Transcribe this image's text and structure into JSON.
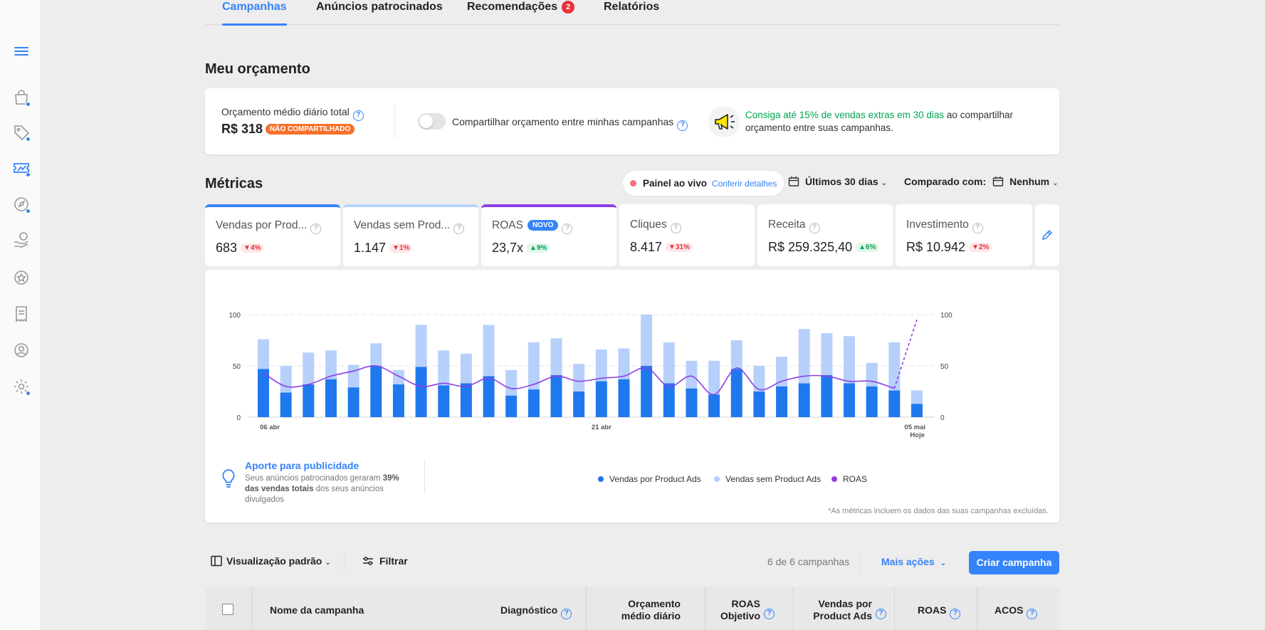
{
  "tabs": [
    {
      "label": "Campanhas"
    },
    {
      "label": "Anúncios patrocinados"
    },
    {
      "label": "Recomendações",
      "badge": "2"
    },
    {
      "label": "Relatórios"
    }
  ],
  "sidebar": {
    "icons": [
      "menu-icon",
      "shopping-bag-icon",
      "tag-icon",
      "ads-ticket-icon",
      "compass-icon",
      "money-hand-icon",
      "star-badge-icon",
      "receipt-icon",
      "user-icon",
      "settings-icon"
    ]
  },
  "budget": {
    "title": "Meu orçamento",
    "label": "Orçamento médio diário total",
    "value": "R$ 318",
    "badge": "NÃO COMPARTILHADO",
    "share_label": "Compartilhar orçamento entre minhas campanhas",
    "promo_highlight": "Consiga até 15% de vendas extras em 30 dias",
    "promo_rest": " ao compartilhar orçamento entre suas campanhas."
  },
  "metrics": {
    "title": "Métricas",
    "live_label": "Painel ao vivo",
    "live_link": "Conferir detalhes",
    "period": "Últimos 30 dias",
    "compare_label": "Comparado com:",
    "compare_value": "Nenhum",
    "tiles": [
      {
        "name": "Vendas por Prod...",
        "value": "683",
        "delta": "▼4%"
      },
      {
        "name": "Vendas sem Prod...",
        "value": "1.147",
        "delta": "▼1%"
      },
      {
        "name": "ROAS",
        "badge": "NOVO",
        "value": "23,7x",
        "delta": "▲9%"
      },
      {
        "name": "Cliques",
        "value": "8.417",
        "delta": "▼31%"
      },
      {
        "name": "Receita",
        "value": "R$ 259.325,40",
        "delta": "▲6%"
      },
      {
        "name": "Investimento",
        "value": "R$ 10.942",
        "delta": "▼2%"
      }
    ]
  },
  "chart_data": {
    "type": "bar",
    "categories": [
      "06 abr",
      "07 abr",
      "08 abr",
      "09 abr",
      "10 abr",
      "11 abr",
      "12 abr",
      "13 abr",
      "14 abr",
      "15 abr",
      "16 abr",
      "17 abr",
      "18 abr",
      "19 abr",
      "20 abr",
      "21 abr",
      "22 abr",
      "23 abr",
      "24 abr",
      "25 abr",
      "26 abr",
      "27 abr",
      "28 abr",
      "29 abr",
      "30 abr",
      "01 mai",
      "02 mai",
      "03 mai",
      "04 mai",
      "05 mai"
    ],
    "x_tick_labels": [
      "06 abr",
      "21 abr",
      "05 mai"
    ],
    "x_tick_sublabel": "Hoje",
    "ylim": [
      0,
      100
    ],
    "y_ticks": [
      "0",
      "50",
      "100"
    ],
    "grid": true,
    "series": [
      {
        "name": "Vendas por Product Ads",
        "color": "#1f78ee",
        "values": [
          47,
          24,
          32,
          37,
          29,
          50,
          32,
          49,
          31,
          33,
          40,
          21,
          27,
          41,
          25,
          35,
          37,
          50,
          33,
          28,
          22,
          47,
          25,
          30,
          33,
          41,
          33,
          30,
          26,
          13
        ]
      },
      {
        "name": "Vendas sem Product Ads",
        "color": "#b7d0fb",
        "values": [
          29,
          26,
          31,
          28,
          22,
          22,
          14,
          41,
          34,
          29,
          50,
          25,
          46,
          36,
          27,
          31,
          30,
          50,
          40,
          27,
          33,
          28,
          25,
          29,
          53,
          41,
          46,
          23,
          47,
          13
        ]
      },
      {
        "name": "ROAS",
        "color": "#8c3fe6",
        "type": "line",
        "values": [
          43,
          30,
          32,
          40,
          45,
          50,
          40,
          30,
          33,
          30,
          38,
          28,
          32,
          40,
          35,
          38,
          40,
          48,
          30,
          40,
          22,
          48,
          27,
          35,
          40,
          40,
          35,
          35,
          28,
          95
        ]
      }
    ],
    "legend_position": "bottom-center"
  },
  "insight": {
    "title": "Aporte para publicidade",
    "text_1": "Seus anúncios patrocinados geraram ",
    "bold_1": "39% das vendas totais",
    "text_2": " dos seus anúncios divulgados"
  },
  "footnote": "*As métricas incluem os dados das suas campanhas excluídas.",
  "toolbar": {
    "view_label": "Visualização padrão",
    "filter_label": "Filtrar",
    "count_text": "6 de 6 campanhas",
    "more_actions": "Mais ações",
    "create_label": "Criar campanha"
  },
  "table": {
    "headers": [
      {
        "label": "Nome da campanha"
      },
      {
        "label": "Diagnóstico"
      },
      {
        "label": "Orçamento médio diário"
      },
      {
        "label": "ROAS Objetivo"
      },
      {
        "label": "Vendas por Product Ads"
      },
      {
        "label": "ROAS"
      },
      {
        "label": "ACOS"
      }
    ]
  },
  "colors": {
    "accent": "#3483fa",
    "bar_dark": "#1f78ee",
    "bar_light": "#b7d0fb",
    "line": "#8c3fe6",
    "orange": "#f7712d",
    "green": "#00a650",
    "red": "#e8313a"
  }
}
